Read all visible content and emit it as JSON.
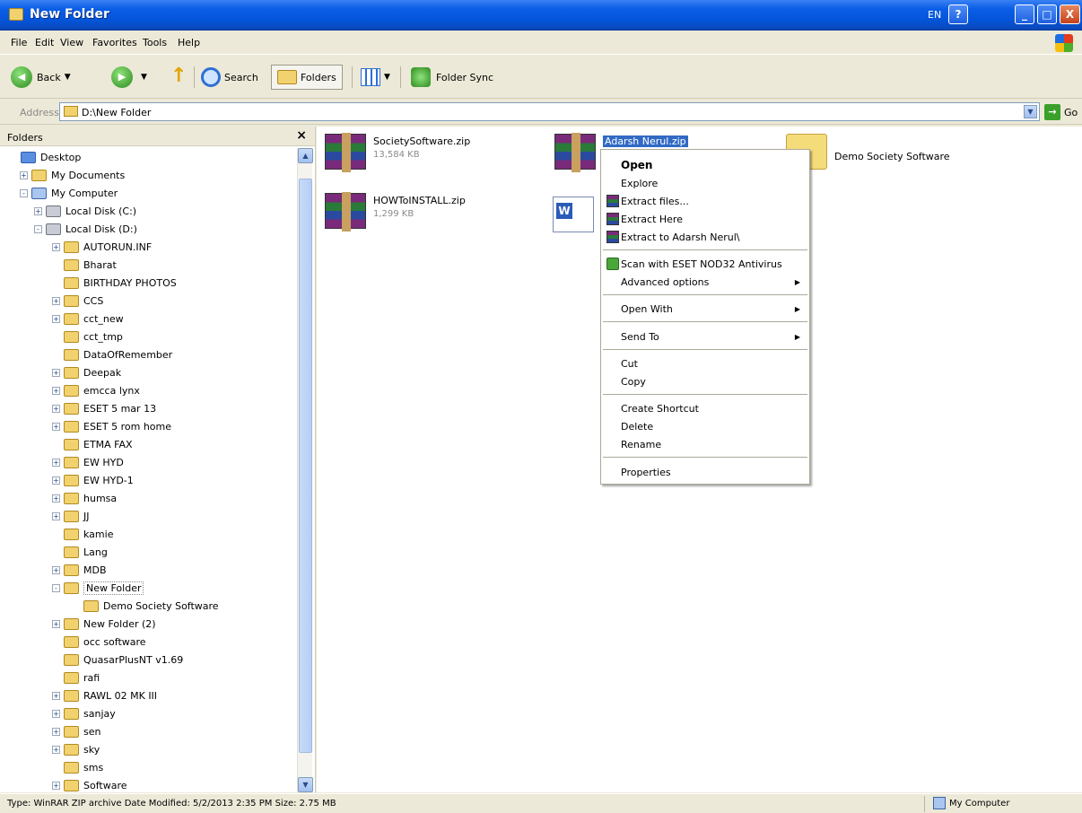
{
  "window": {
    "title": "New Folder",
    "language_indicator": "EN",
    "help_label": "?",
    "minimize_label": "_",
    "maximize_label": "□",
    "close_label": "X"
  },
  "menubar": {
    "items": [
      "File",
      "Edit",
      "View",
      "Favorites",
      "Tools",
      "Help"
    ]
  },
  "toolbar": {
    "back_label": "Back",
    "search_label": "Search",
    "folders_label": "Folders",
    "folder_sync_label": "Folder Sync"
  },
  "address": {
    "label": "Address",
    "value": "D:\\New Folder",
    "go_label": "Go"
  },
  "folders_pane": {
    "title": "Folders",
    "close_label": "×",
    "tree": [
      {
        "label": "Desktop",
        "expander": "",
        "icon": "desk"
      },
      {
        "label": "My Documents",
        "expander": "+",
        "icon": "docs"
      },
      {
        "label": "My Computer",
        "expander": "-",
        "icon": "comp"
      },
      {
        "label": "Local Disk (C:)",
        "expander": "+",
        "icon": "disk"
      },
      {
        "label": "Local Disk (D:)",
        "expander": "-",
        "icon": "disk"
      },
      {
        "label": "AUTORUN.INF",
        "expander": "+",
        "icon": "folder"
      },
      {
        "label": "Bharat",
        "expander": "",
        "icon": "folder"
      },
      {
        "label": "BIRTHDAY PHOTOS",
        "expander": "",
        "icon": "folder"
      },
      {
        "label": "CCS",
        "expander": "+",
        "icon": "folder"
      },
      {
        "label": "cct_new",
        "expander": "+",
        "icon": "folder"
      },
      {
        "label": "cct_tmp",
        "expander": "",
        "icon": "folder"
      },
      {
        "label": "DataOfRemember",
        "expander": "",
        "icon": "folder"
      },
      {
        "label": "Deepak",
        "expander": "+",
        "icon": "folder"
      },
      {
        "label": "emcca lynx",
        "expander": "+",
        "icon": "folder"
      },
      {
        "label": "ESET 5 mar 13",
        "expander": "+",
        "icon": "folder"
      },
      {
        "label": "ESET 5 rom home",
        "expander": "+",
        "icon": "folder"
      },
      {
        "label": "ETMA FAX",
        "expander": "",
        "icon": "folder"
      },
      {
        "label": "EW HYD",
        "expander": "+",
        "icon": "folder"
      },
      {
        "label": "EW HYD-1",
        "expander": "+",
        "icon": "folder"
      },
      {
        "label": "humsa",
        "expander": "+",
        "icon": "folder"
      },
      {
        "label": "JJ",
        "expander": "+",
        "icon": "folder"
      },
      {
        "label": "kamie",
        "expander": "",
        "icon": "folder"
      },
      {
        "label": "Lang",
        "expander": "",
        "icon": "folder"
      },
      {
        "label": "MDB",
        "expander": "+",
        "icon": "folder"
      },
      {
        "label": "New Folder",
        "expander": "-",
        "icon": "folder"
      },
      {
        "label": "Demo Society Software",
        "expander": "",
        "icon": "folder"
      },
      {
        "label": "New Folder (2)",
        "expander": "+",
        "icon": "folder"
      },
      {
        "label": "occ software",
        "expander": "",
        "icon": "folder"
      },
      {
        "label": "QuasarPlusNT v1.69",
        "expander": "",
        "icon": "folder"
      },
      {
        "label": "rafi",
        "expander": "",
        "icon": "folder"
      },
      {
        "label": "RAWL 02 MK III",
        "expander": "+",
        "icon": "folder"
      },
      {
        "label": "sanjay",
        "expander": "+",
        "icon": "folder"
      },
      {
        "label": "sen",
        "expander": "+",
        "icon": "folder"
      },
      {
        "label": "sky",
        "expander": "+",
        "icon": "folder"
      },
      {
        "label": "sms",
        "expander": "",
        "icon": "folder"
      },
      {
        "label": "Software",
        "expander": "+",
        "icon": "folder"
      }
    ]
  },
  "files": [
    {
      "name": "SocietySoftware.zip",
      "meta": "13,584 KB",
      "icon": "rar"
    },
    {
      "name": "Adarsh Nerul.zip",
      "meta": "",
      "icon": "rar"
    },
    {
      "name": "Demo Society Software",
      "meta": "",
      "icon": "folder"
    },
    {
      "name": "HOWToINSTALL.zip",
      "meta": "1,299 KB",
      "icon": "rar"
    },
    {
      "name": "",
      "meta": "",
      "icon": "word"
    }
  ],
  "context_menu": {
    "items": [
      {
        "label": "Open"
      },
      {
        "label": "Explore"
      },
      {
        "label": "Extract files..."
      },
      {
        "label": "Extract Here"
      },
      {
        "label": "Extract to Adarsh Nerul\\"
      },
      {
        "label": "Scan with ESET NOD32 Antivirus"
      },
      {
        "label": "Advanced options"
      },
      {
        "label": "Open With"
      },
      {
        "label": "Send To"
      },
      {
        "label": "Cut"
      },
      {
        "label": "Copy"
      },
      {
        "label": "Create Shortcut"
      },
      {
        "label": "Delete"
      },
      {
        "label": "Rename"
      },
      {
        "label": "Properties"
      }
    ]
  },
  "statusbar": {
    "text": "Type: WinRAR ZIP archive Date Modified: 5/2/2013 2:35 PM Size: 2.75 MB",
    "zone": "My Computer"
  }
}
